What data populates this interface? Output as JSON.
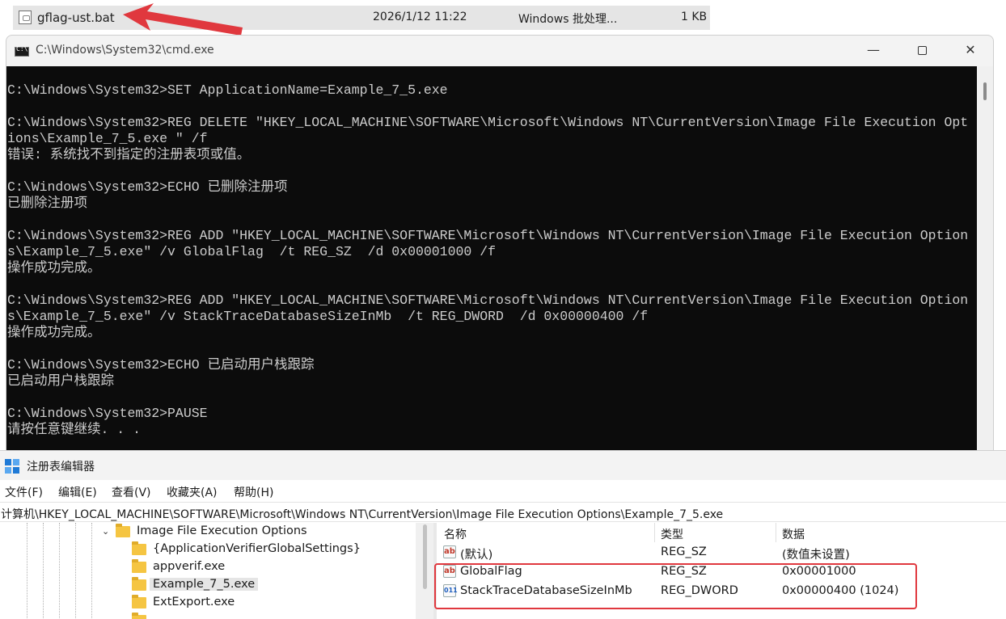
{
  "explorer": {
    "file_name": "gflag-ust.bat",
    "file_date": "2026/1/12 11:22",
    "file_type": "Windows 批处理...",
    "file_size": "1 KB"
  },
  "cmd": {
    "title": "C:\\Windows\\System32\\cmd.exe",
    "controls": {
      "minimize": "—",
      "close": "✕"
    },
    "lines": [
      "C:\\Windows\\System32>SET ApplicationName=Example_7_5.exe",
      "",
      "C:\\Windows\\System32>REG DELETE \"HKEY_LOCAL_MACHINE\\SOFTWARE\\Microsoft\\Windows NT\\CurrentVersion\\Image File Execution Opt",
      "ions\\Example_7_5.exe \" /f",
      "错误: 系统找不到指定的注册表项或值。",
      "",
      "C:\\Windows\\System32>ECHO 已删除注册项",
      "已删除注册项",
      "",
      "C:\\Windows\\System32>REG ADD \"HKEY_LOCAL_MACHINE\\SOFTWARE\\Microsoft\\Windows NT\\CurrentVersion\\Image File Execution Option",
      "s\\Example_7_5.exe\" /v GlobalFlag  /t REG_SZ  /d 0x00001000 /f",
      "操作成功完成。",
      "",
      "C:\\Windows\\System32>REG ADD \"HKEY_LOCAL_MACHINE\\SOFTWARE\\Microsoft\\Windows NT\\CurrentVersion\\Image File Execution Option",
      "s\\Example_7_5.exe\" /v StackTraceDatabaseSizeInMb  /t REG_DWORD  /d 0x00000400 /f",
      "操作成功完成。",
      "",
      "C:\\Windows\\System32>ECHO 已启动用户栈跟踪",
      "已启动用户栈跟踪",
      "",
      "C:\\Windows\\System32>PAUSE",
      "请按任意键继续. . ."
    ]
  },
  "regedit": {
    "title": "注册表编辑器",
    "menu": [
      "文件(F)",
      "编辑(E)",
      "查看(V)",
      "收藏夹(A)",
      "帮助(H)"
    ],
    "address": "计算机\\HKEY_LOCAL_MACHINE\\SOFTWARE\\Microsoft\\Windows NT\\CurrentVersion\\Image File Execution Options\\Example_7_5.exe",
    "tree": {
      "parent": "Image File Execution Options",
      "children": [
        "{ApplicationVerifierGlobalSettings}",
        "appverif.exe",
        "Example_7_5.exe",
        "ExtExport.exe"
      ],
      "selected": "Example_7_5.exe"
    },
    "columns": [
      "名称",
      "类型",
      "数据"
    ],
    "values": [
      {
        "name": "(默认)",
        "type": "REG_SZ",
        "data": "(数值未设置)",
        "icon": "string-value-icon"
      },
      {
        "name": "GlobalFlag",
        "type": "REG_SZ",
        "data": "0x00001000",
        "icon": "string-value-icon"
      },
      {
        "name": "StackTraceDatabaseSizeInMb",
        "type": "REG_DWORD",
        "data": "0x00000400 (1024)",
        "icon": "binary-value-icon"
      }
    ]
  },
  "colors": {
    "annotation_red": "#e0383e",
    "console_bg": "#0c0c0c",
    "console_fg": "#cccccc",
    "folder": "#f5c542"
  }
}
